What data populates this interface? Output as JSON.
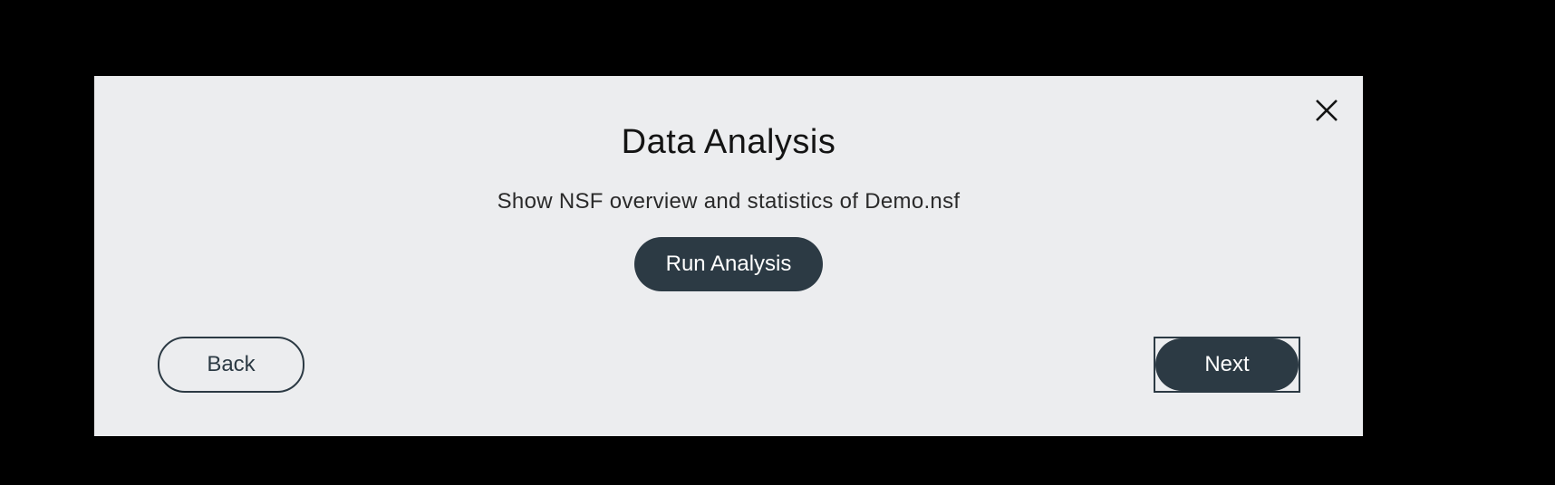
{
  "dialog": {
    "title": "Data Analysis",
    "subtitle": "Show NSF overview and statistics of Demo.nsf",
    "close_icon": "close-icon",
    "run_label": "Run Analysis",
    "back_label": "Back",
    "next_label": "Next"
  },
  "colors": {
    "background": "#000000",
    "dialog_bg": "#ecedef",
    "primary": "#2c3a44",
    "text": "#141414"
  }
}
